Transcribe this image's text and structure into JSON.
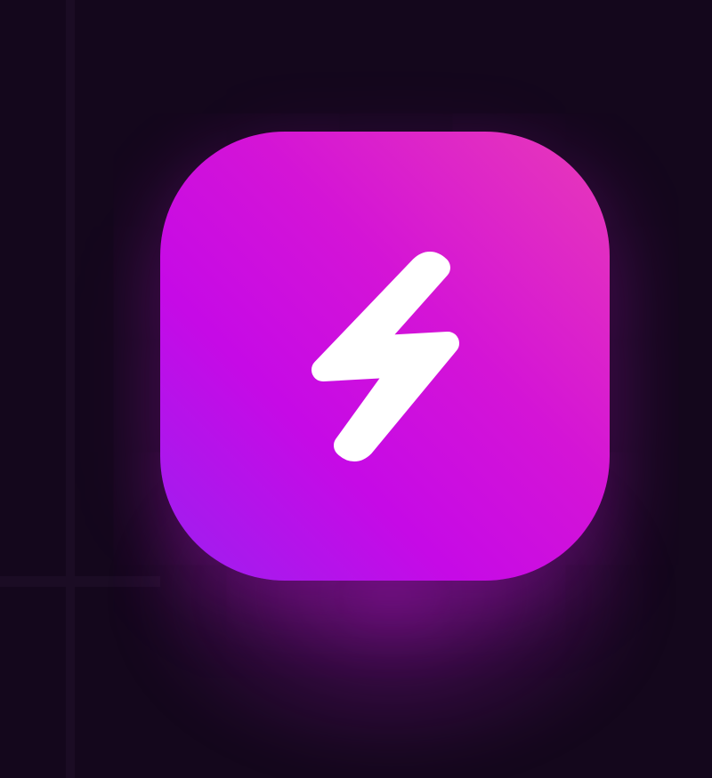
{
  "app_icon": {
    "icon": "lightning-bolt-icon",
    "gradient_colors": [
      "#9b20f0",
      "#c60ae6",
      "#d414d6",
      "#e83ab8"
    ],
    "glyph_color": "#ffffff"
  },
  "background_color": "#14071c"
}
